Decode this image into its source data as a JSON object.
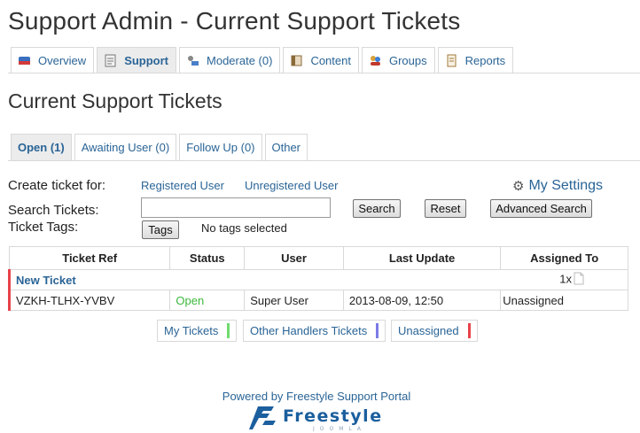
{
  "page": {
    "title": "Support Admin - Current Support Tickets"
  },
  "main_tabs": [
    {
      "label": "Overview",
      "icon": "overview-icon"
    },
    {
      "label": "Support",
      "icon": "support-icon",
      "active": true
    },
    {
      "label": "Moderate (0)",
      "icon": "moderate-icon"
    },
    {
      "label": "Content",
      "icon": "content-icon"
    },
    {
      "label": "Groups",
      "icon": "groups-icon"
    },
    {
      "label": "Reports",
      "icon": "reports-icon"
    }
  ],
  "section": {
    "title": "Current Support Tickets"
  },
  "sub_tabs": [
    {
      "label": "Open (1)",
      "active": true
    },
    {
      "label": "Awaiting User (0)"
    },
    {
      "label": "Follow Up (0)"
    },
    {
      "label": "Other"
    }
  ],
  "create": {
    "label": "Create ticket for:",
    "registered": "Registered User",
    "unregistered": "Unregistered User"
  },
  "settings": {
    "label": "My Settings",
    "icon": "gear-icon"
  },
  "search": {
    "label": "Search Tickets:",
    "value": "",
    "search_button": "Search",
    "reset_button": "Reset",
    "advanced_button": "Advanced Search"
  },
  "tags": {
    "label": "Ticket Tags:",
    "button": "Tags",
    "status": "No tags selected"
  },
  "table": {
    "headers": [
      "Ticket Ref",
      "Status",
      "User",
      "Last Update",
      "Assigned To"
    ],
    "new_ticket_label": "New Ticket",
    "new_ticket_count": "1x",
    "rows": [
      {
        "ref": "VZKH-TLHX-YVBV",
        "status": "Open",
        "user": "Super User",
        "updated": "2013-08-09, 12:50",
        "assigned": "Unassigned"
      }
    ]
  },
  "legend": [
    {
      "label": "My Tickets",
      "color": "#6fdc6f"
    },
    {
      "label": "Other Handlers Tickets",
      "color": "#7b7be8"
    },
    {
      "label": "Unassigned",
      "color": "#e8424a"
    }
  ],
  "footer": {
    "text": "Powered by Freestyle Support Portal",
    "logo_text": "Freestyle",
    "logo_subtext": "JOOMLA"
  }
}
